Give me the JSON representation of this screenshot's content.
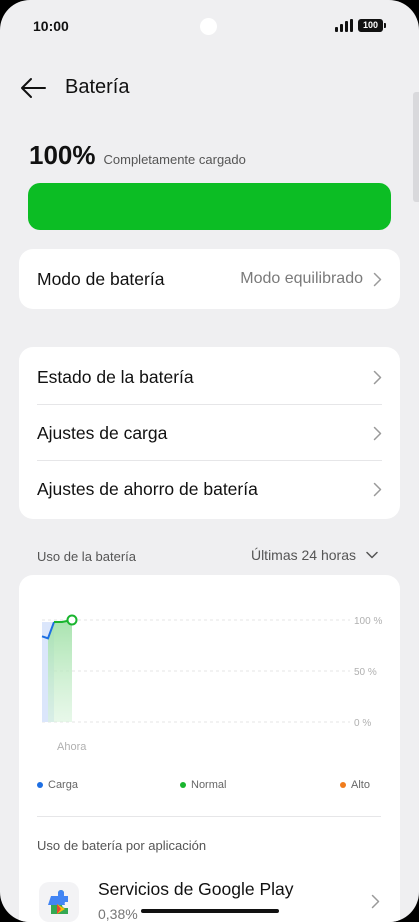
{
  "status_bar": {
    "time": "10:00",
    "battery": "100"
  },
  "header": {
    "title": "Batería"
  },
  "battery": {
    "level": "100%",
    "status": "Completamente cargado",
    "fill": 1.0,
    "color": "#0cbd24"
  },
  "mode_card": {
    "label": "Modo de batería",
    "value": "Modo equilibrado"
  },
  "settings": [
    {
      "label": "Estado de la batería"
    },
    {
      "label": "Ajustes de carga"
    },
    {
      "label": "Ajustes de ahorro de batería"
    }
  ],
  "usage": {
    "title": "Uso de la batería",
    "range": "Últimas 24 horas",
    "legend": [
      {
        "label": "Carga",
        "color": "#1e6fe3"
      },
      {
        "label": "Normal",
        "color": "#19b52e"
      },
      {
        "label": "Alto",
        "color": "#f07c1c"
      }
    ],
    "per_app_title": "Uso de batería por aplicación"
  },
  "chart_data": {
    "type": "area",
    "y_ticks": [
      "100 %",
      "50 %",
      "0 %"
    ],
    "x_label": "Ahora",
    "ylim": [
      0,
      100
    ],
    "points": [
      84,
      82,
      98,
      98,
      100
    ]
  },
  "apps": [
    {
      "name": "Servicios de Google Play",
      "percent": "0,38%",
      "icon": "google-play-services-icon"
    }
  ]
}
